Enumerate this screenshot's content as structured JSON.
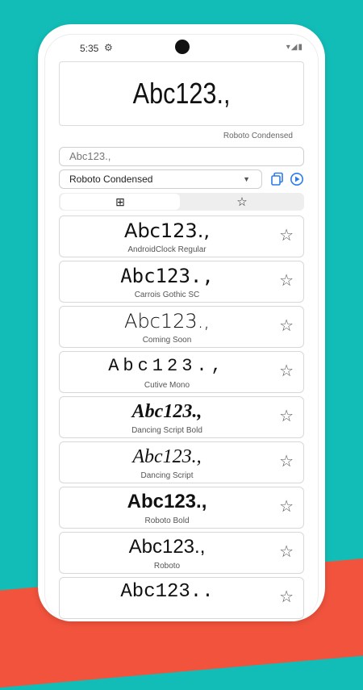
{
  "status": {
    "time": "5:35",
    "settings_icon": "gear-icon",
    "system_icons": "▾◢▮"
  },
  "preview": {
    "text": "Abc123.,",
    "font_name": "Roboto Condensed"
  },
  "input": {
    "value": "Abc123.,"
  },
  "selector": {
    "selected": "Roboto Condensed",
    "dropdown_icon": "▼"
  },
  "toggle": {
    "grid_icon": "⊞",
    "fav_icon": "☆"
  },
  "fonts": [
    {
      "sample": "Abc123.,",
      "name": "AndroidClock Regular"
    },
    {
      "sample": "Abc123.,",
      "name": "Carrois Gothic SC"
    },
    {
      "sample": "Abc123.,",
      "name": "Coming Soon"
    },
    {
      "sample": "Abc123.,",
      "name": "Cutive Mono"
    },
    {
      "sample": "Abc123.,",
      "name": "Dancing Script Bold"
    },
    {
      "sample": "Abc123.,",
      "name": "Dancing Script"
    },
    {
      "sample": "Abc123.,",
      "name": "Roboto Bold"
    },
    {
      "sample": "Abc123.,",
      "name": "Roboto"
    },
    {
      "sample": "Abc123..",
      "name": ""
    }
  ],
  "star": "☆",
  "colors": {
    "teal": "#13bdb7",
    "coral": "#f2533d",
    "accent": "#2d7be6"
  }
}
